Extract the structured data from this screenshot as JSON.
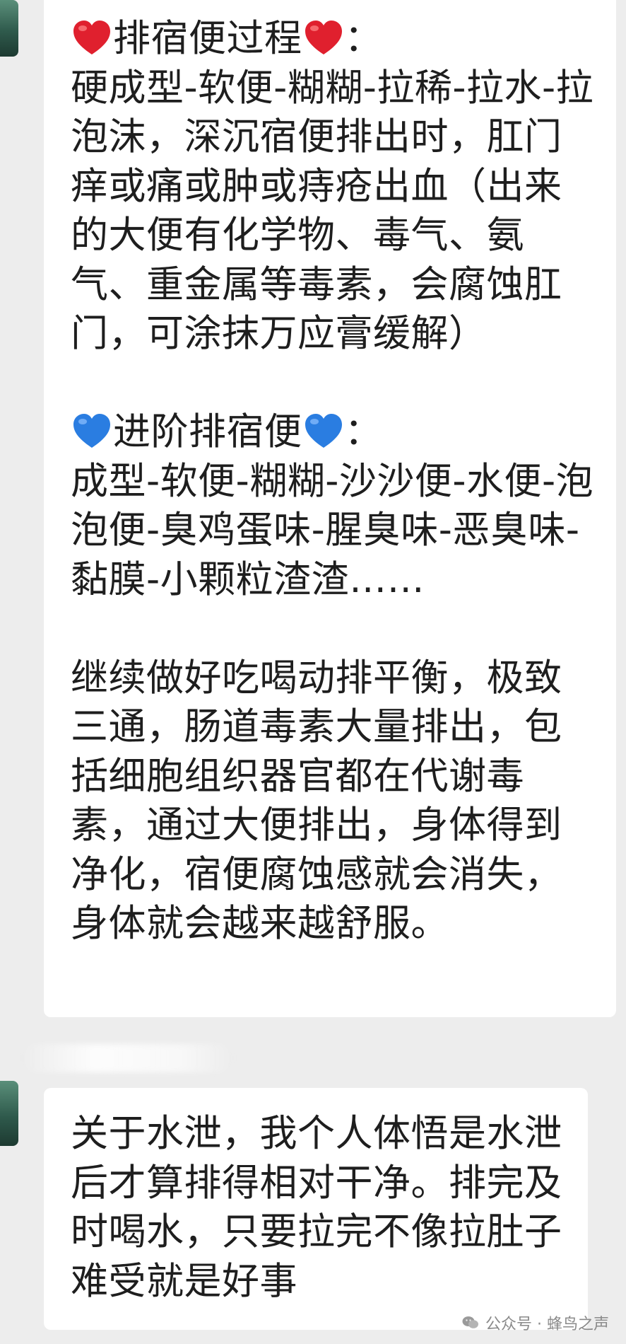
{
  "colors": {
    "background": "#ededed",
    "bubble": "#ffffff",
    "text": "#1e1e1e",
    "red_heart": "#e0202e",
    "blue_heart": "#2a7de1",
    "watermark": "#8a8a8a"
  },
  "message1": {
    "section1": {
      "heading_icon": "red-heart-icon",
      "heading_text": "排宿便过程",
      "heading_suffix": "：",
      "body": "硬成型-软便-糊糊-拉稀-拉水-拉泡沫，深沉宿便排出时，肛门痒或痛或肿或痔疮出血（出来的大便有化学物、毒气、氨气、重金属等毒素，会腐蚀肛门，可涂抹万应膏缓解）"
    },
    "section2": {
      "heading_icon": "blue-heart-icon",
      "heading_text": "进阶排宿便",
      "heading_suffix": "：",
      "body": "成型-软便-糊糊-沙沙便-水便-泡泡便-臭鸡蛋味-腥臭味-恶臭味-黏膜-小颗粒渣渣……"
    },
    "section3": {
      "body": "继续做好吃喝动排平衡，极致三通，肠道毒素大量排出，包括细胞组织器官都在代谢毒素，通过大便排出，身体得到净化，宿便腐蚀感就会消失，身体就会越来越舒服。"
    }
  },
  "message2": {
    "body": "关于水泄，我个人体悟是水泄后才算排得相对干净。排完及时喝水，只要拉完不像拉肚子难受就是好事"
  },
  "watermark": {
    "icon": "wechat-icon",
    "text": "公众号 · 蜂鸟之声"
  }
}
